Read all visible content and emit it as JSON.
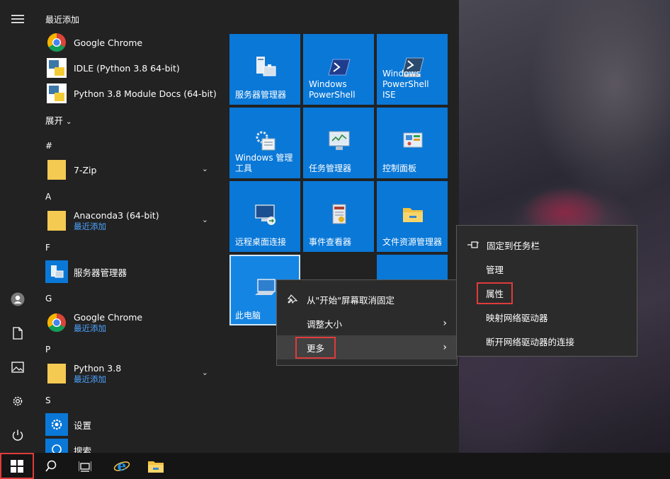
{
  "recent": {
    "header": "最近添加",
    "items": [
      {
        "name": "Google Chrome"
      },
      {
        "name": "IDLE (Python 3.8 64-bit)"
      },
      {
        "name": "Python 3.8 Module Docs (64-bit)"
      }
    ]
  },
  "expand_label": "展开",
  "groups": {
    "hash": {
      "header": "#",
      "items": [
        {
          "name": "7-Zip"
        }
      ]
    },
    "a": {
      "header": "A",
      "items": [
        {
          "name": "Anaconda3 (64-bit)",
          "sub": "最近添加"
        }
      ]
    },
    "f": {
      "header": "F",
      "items": [
        {
          "name": "服务器管理器"
        }
      ]
    },
    "g": {
      "header": "G",
      "items": [
        {
          "name": "Google Chrome",
          "sub": "最近添加"
        }
      ]
    },
    "p": {
      "header": "P",
      "items": [
        {
          "name": "Python 3.8",
          "sub": "最近添加"
        }
      ]
    },
    "s": {
      "header": "S",
      "items": [
        {
          "name": "设置"
        },
        {
          "name": "搜索"
        }
      ]
    }
  },
  "tiles": [
    {
      "label": "服务器管理器",
      "icon": "server-manager-icon"
    },
    {
      "label": "Windows PowerShell",
      "icon": "powershell-icon"
    },
    {
      "label": "Windows PowerShell ISE",
      "icon": "powershell-ise-icon"
    },
    {
      "label": "Windows 管理工具",
      "icon": "admin-tools-icon"
    },
    {
      "label": "任务管理器",
      "icon": "task-manager-icon"
    },
    {
      "label": "控制面板",
      "icon": "control-panel-icon"
    },
    {
      "label": "远程桌面连接",
      "icon": "remote-desktop-icon"
    },
    {
      "label": "事件查看器",
      "icon": "event-viewer-icon"
    },
    {
      "label": "文件资源管理器",
      "icon": "file-explorer-icon"
    },
    {
      "label": "此电脑",
      "icon": "this-pc-icon"
    }
  ],
  "context_menu": {
    "items": [
      {
        "label": "从\"开始\"屏幕取消固定"
      },
      {
        "label": "调整大小"
      },
      {
        "label": "更多"
      }
    ]
  },
  "submenu": {
    "items": [
      {
        "label": "固定到任务栏"
      },
      {
        "label": "管理"
      },
      {
        "label": "属性"
      },
      {
        "label": "映射网络驱动器"
      },
      {
        "label": "断开网络驱动器的连接"
      }
    ]
  },
  "colors": {
    "tile": "#0a78d7",
    "accent_text": "#4ca3ff",
    "highlight_box": "#e03b3b"
  }
}
